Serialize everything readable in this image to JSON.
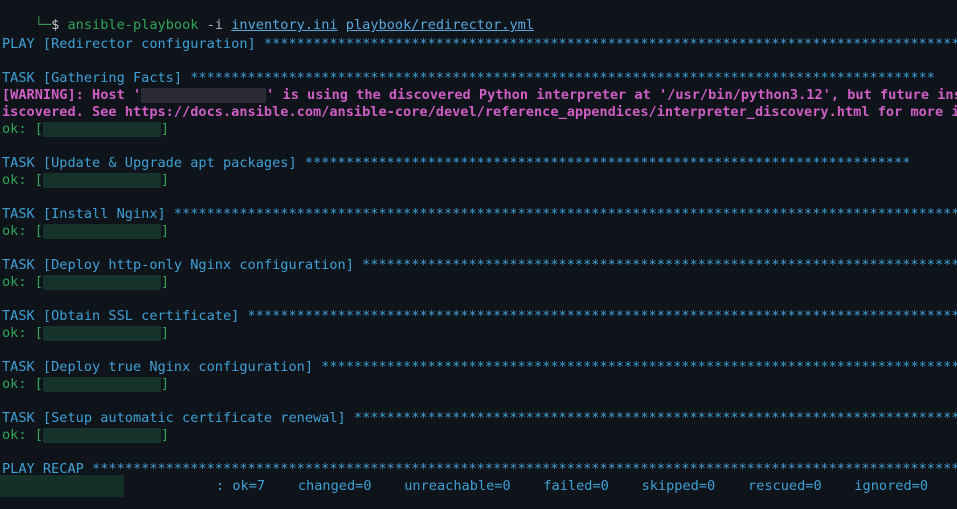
{
  "prompt": {
    "corner": "└─",
    "symbol": "$",
    "command": "ansible-playbook",
    "flag": "-i",
    "inventory": "inventory.ini",
    "playbook": "playbook/redirector.yml"
  },
  "play": {
    "header": "PLAY [Redirector configuration] ******************************************************************************************"
  },
  "tasks": [
    {
      "header": "TASK [Gathering Facts] *******************************************************************************************",
      "result": "ok: [",
      "end": "]"
    },
    {
      "header": "TASK [Update & Upgrade apt packages] **************************************************************************",
      "result": "ok: [",
      "end": "]"
    },
    {
      "header": "TASK [Install Nginx] **************************************************************************************************",
      "result": "ok: [",
      "end": "]"
    },
    {
      "header": "TASK [Deploy http-only Nginx configuration] **************************************************************************",
      "result": "ok: [",
      "end": "]"
    },
    {
      "header": "TASK [Obtain SSL certificate] ********************************************************************************************",
      "result": "ok: [",
      "end": "]"
    },
    {
      "header": "TASK [Deploy true Nginx configuration] ********************************************************************************",
      "result": "ok: [",
      "end": "]"
    },
    {
      "header": "TASK [Setup automatic certificate renewal] ****************************************************************************",
      "result": "ok: [",
      "end": "]"
    }
  ],
  "warning": {
    "line1_a": "[WARNING]: Host '",
    "line1_b": "' is using the discovered Python interpreter at '/usr/bin/python3.12', but future instal",
    "line2": "iscovered. See https://docs.ansible.com/ansible-core/devel/reference_appendices/interpreter_discovery.html for more info"
  },
  "recap": {
    "header": "PLAY RECAP ************************************************************************************************************",
    "stats": ": ok=7    changed=0    unreachable=0    failed=0    skipped=0    rescued=0    ignored=0"
  },
  "colors": {
    "background": "#0e1419",
    "task": "#3fa0d8",
    "ok": "#2fa55a",
    "warning": "#d05ec7"
  }
}
